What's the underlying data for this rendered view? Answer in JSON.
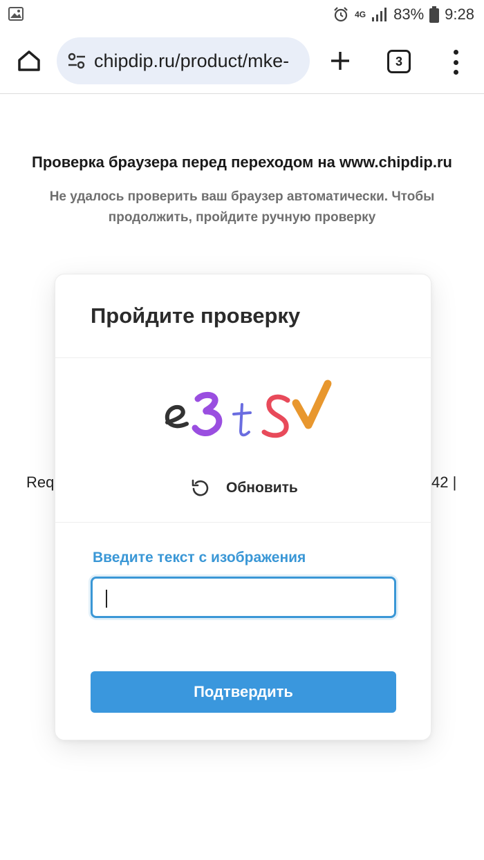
{
  "status_bar": {
    "network": "4G",
    "battery": "83%",
    "time": "9:28",
    "icons": [
      "image-icon",
      "alarm-icon",
      "network-icon",
      "signal-icon",
      "battery-icon"
    ]
  },
  "browser": {
    "url": "chipdip.ru/product/mke-",
    "tab_count": "3",
    "icons": [
      "home-icon",
      "tune-icon",
      "plus-icon",
      "tabs-icon",
      "more-vert-icon"
    ]
  },
  "page": {
    "heading": "Проверка браузера перед переходом на www.chipdip.ru",
    "subheading": "Не удалось проверить ваш браузер автоматически. Чтобы продолжить, пройдите ручную проверку",
    "bg_left_fragment": "Req",
    "bg_right_fragment": "42 |"
  },
  "modal": {
    "title": "Пройдите проверку",
    "captcha_image_text": "e3tsv",
    "refresh_label": "Обновить",
    "input_label": "Введите текст с изображения",
    "input_value": "",
    "submit_label": "Подтвердить"
  },
  "colors": {
    "accent": "#3a97dd",
    "label": "#3a97d6",
    "url_bar": "#e9eef8"
  }
}
